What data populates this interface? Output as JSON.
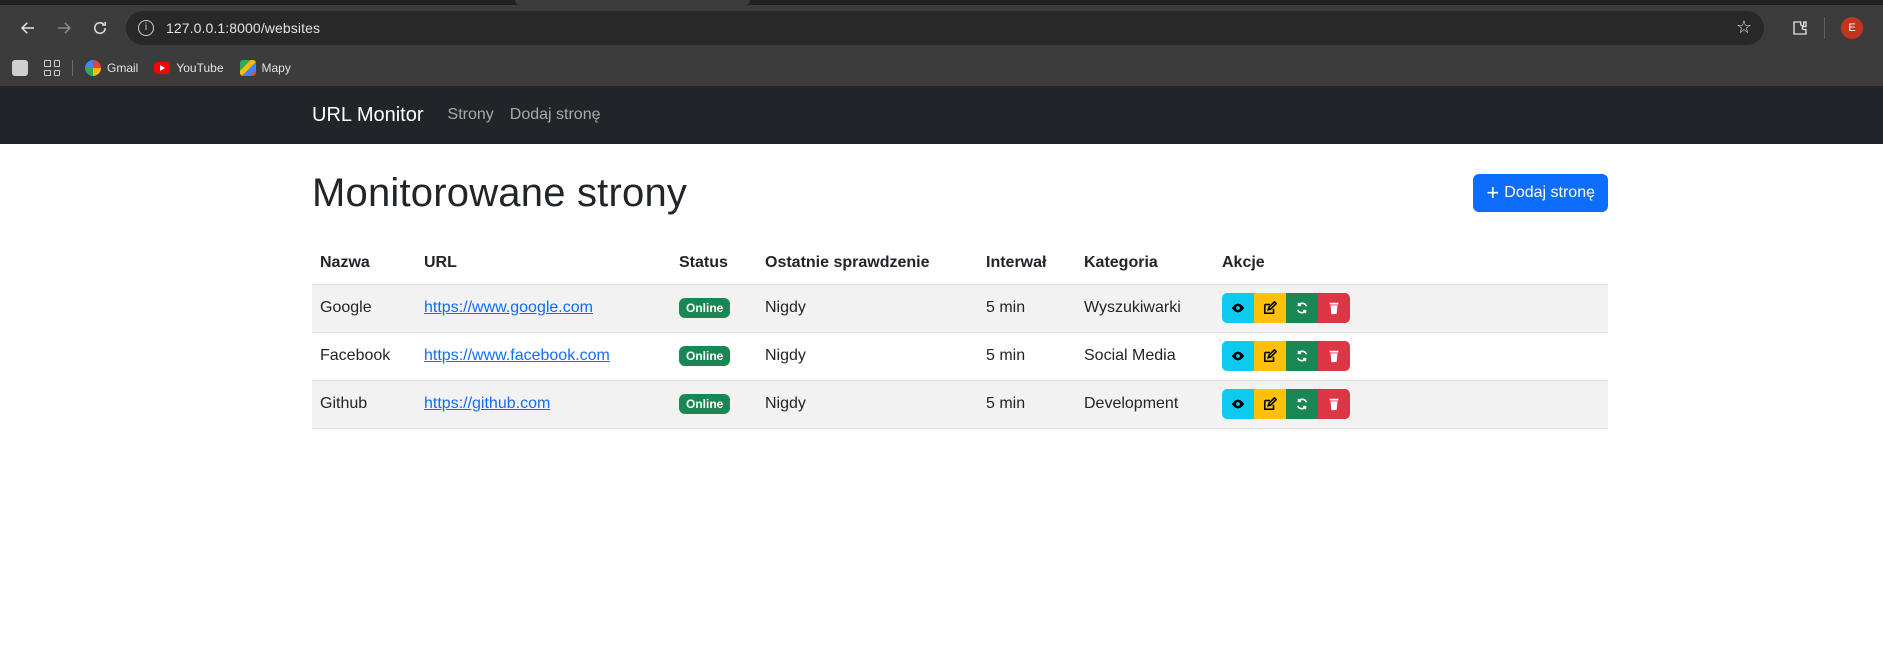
{
  "browser": {
    "url": "127.0.0.1:8000/websites",
    "profile_initial": "E",
    "bookmarks": [
      {
        "label": "Gmail",
        "icon": "google-icon"
      },
      {
        "label": "YouTube",
        "icon": "youtube-icon"
      },
      {
        "label": "Mapy",
        "icon": "maps-icon"
      }
    ]
  },
  "navbar": {
    "brand": "URL Monitor",
    "links": [
      "Strony",
      "Dodaj stronę"
    ]
  },
  "main": {
    "title": "Monitorowane strony",
    "add_button": "Dodaj stronę",
    "columns": [
      "Nazwa",
      "URL",
      "Status",
      "Ostatnie sprawdzenie",
      "Interwał",
      "Kategoria",
      "Akcje"
    ],
    "rows": [
      {
        "name": "Google",
        "url": "https://www.google.com",
        "status": "Online",
        "last_check": "Nigdy",
        "interval": "5 min",
        "category": "Wyszukiwarki"
      },
      {
        "name": "Facebook",
        "url": "https://www.facebook.com",
        "status": "Online",
        "last_check": "Nigdy",
        "interval": "5 min",
        "category": "Social Media"
      },
      {
        "name": "Github",
        "url": "https://github.com",
        "status": "Online",
        "last_check": "Nigdy",
        "interval": "5 min",
        "category": "Development"
      }
    ]
  },
  "colors": {
    "primary": "#0d6efd",
    "info": "#0dcaf0",
    "warning": "#ffc107",
    "success": "#198754",
    "danger": "#dc3545",
    "navbar_bg": "#212529"
  }
}
